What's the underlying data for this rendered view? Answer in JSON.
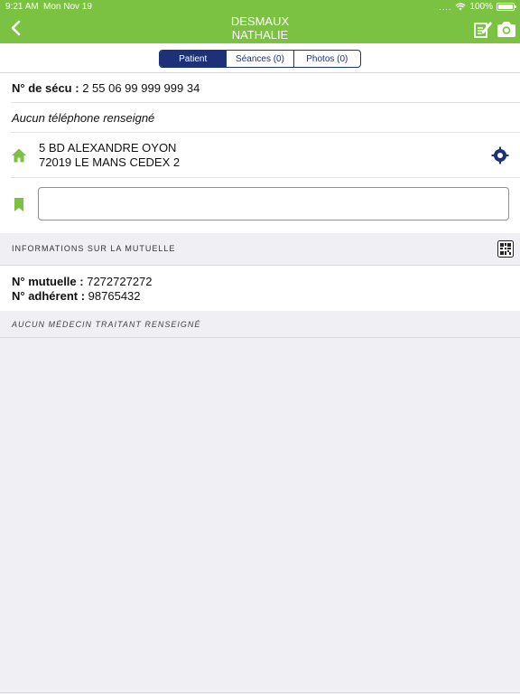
{
  "status_bar": {
    "time": "9:21 AM",
    "date": "Mon Nov 19",
    "signal": "....",
    "battery": "100%"
  },
  "header": {
    "title_line1": "DESMAUX",
    "title_line2": "NATHALIE",
    "color": "#7cc242",
    "icons": [
      "back-chevron-icon",
      "edit-note-icon",
      "camera-icon"
    ]
  },
  "tabs": [
    {
      "label": "Patient",
      "active": true
    },
    {
      "label": "Séances (0)",
      "active": false
    },
    {
      "label": "Photos (0)",
      "active": false
    }
  ],
  "patient": {
    "secu_label": "N° de sécu :",
    "secu_value": "2 55 06 99 999 999 34",
    "phone_text": "Aucun téléphone renseigné",
    "address_line1": "5 BD ALEXANDRE OYON",
    "address_line2": "72019 LE MANS CEDEX 2",
    "note_value": ""
  },
  "mutuelle": {
    "section_title": "INFORMATIONS SUR LA MUTUELLE",
    "mutuelle_label": "N° mutuelle :",
    "mutuelle_value": "7272727272",
    "adherent_label": "N° adhérent :",
    "adherent_value": "98765432"
  },
  "doctor": {
    "text": "AUCUN MÉDECIN TRAITANT RENSEIGNÉ"
  },
  "colors": {
    "accent_green": "#7cc242",
    "navy": "#1c3178",
    "background": "#efeff4"
  }
}
